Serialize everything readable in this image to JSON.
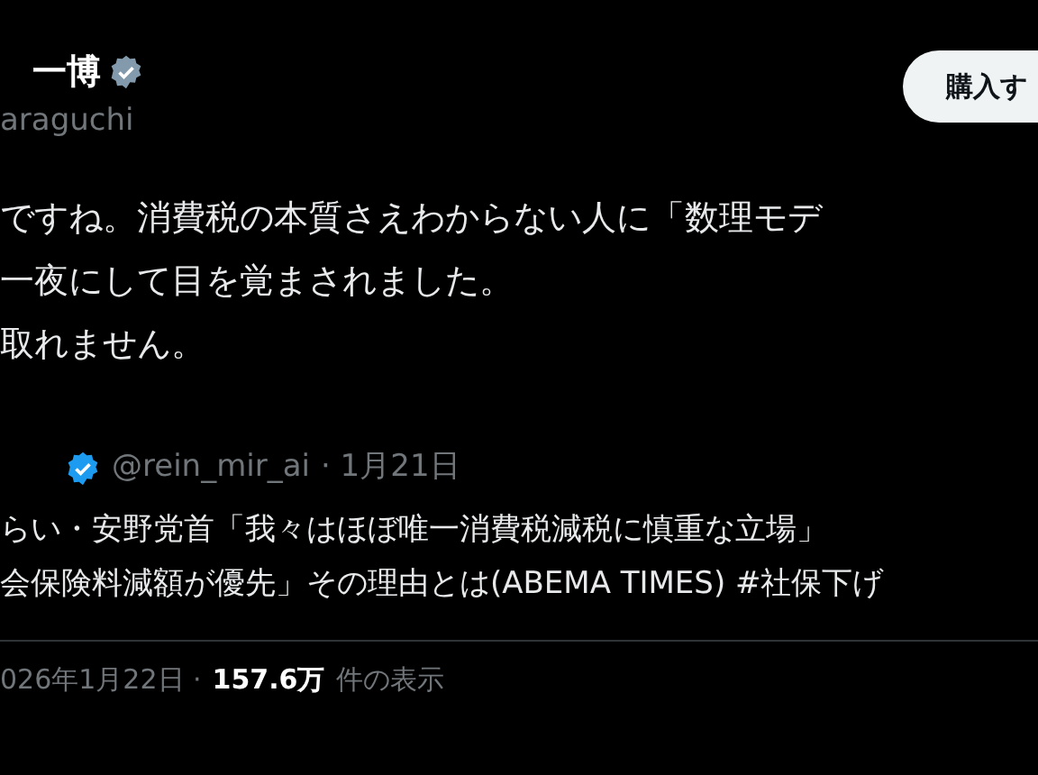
{
  "author": {
    "name": "一博",
    "verified": true,
    "handle": "araguchi"
  },
  "buy_button": {
    "label": "購入す"
  },
  "tweet_lines": [
    "ですね。消費税の本質さえわからない人に「数理モデ",
    "一夜にして目を覚まされました。",
    "取れません。"
  ],
  "quote": {
    "verified": true,
    "handle": "@rein_mir_ai",
    "date": "· 1月21日",
    "lines": [
      "らい・安野党首「我々はほぼ唯一消費税減税に慎重な立場」",
      "会保険料減額が優先」その理由とは(ABEMA TIMES) #社保下げ"
    ]
  },
  "meta": {
    "date": "026年1月22日 ·",
    "views": "157.6万",
    "views_label": "件の表示"
  }
}
